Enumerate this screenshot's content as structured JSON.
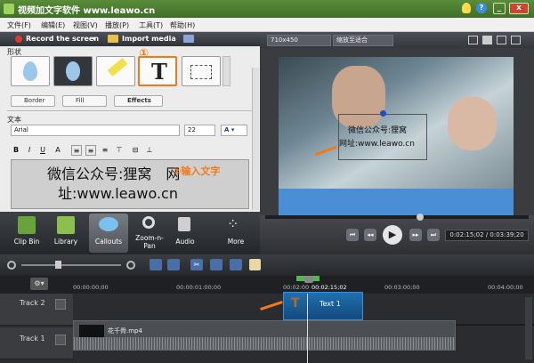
{
  "window": {
    "title": "视频加文字软件 www.leawo.cn"
  },
  "menu": [
    "文件(F)",
    "编辑(E)",
    "视图(V)",
    "播放(P)",
    "工具(T)",
    "帮助(H)"
  ],
  "toolbar": {
    "record_label": "Record the screen",
    "import_label": "Import media"
  },
  "callouts": {
    "shape_label": "形状",
    "border_label": "Border",
    "fill_label": "Fill",
    "effects_label": "Effects",
    "text_label": "文本",
    "font": "Arial",
    "font_size": "22",
    "text_content_line1": "微信公众号:狸窝　网",
    "text_content_line2": "址:www.leawo.cn",
    "step1_marker": "①",
    "step2_label": "②输入文字"
  },
  "tabs": [
    {
      "label": "Clip Bin",
      "icon": "film-icon"
    },
    {
      "label": "Library",
      "icon": "library-icon"
    },
    {
      "label": "Callouts",
      "icon": "speech-bubble-icon"
    },
    {
      "label": "Zoom-n-Pan",
      "icon": "magnifier-icon"
    },
    {
      "label": "Audio",
      "icon": "speaker-icon"
    },
    {
      "label": "More",
      "icon": "more-icon"
    }
  ],
  "preview": {
    "resolution": "710x450",
    "fit_label": "缩放至适合",
    "overlay_line1": "微信公众号:狸窝",
    "overlay_line2": "网址:www.leawo.cn",
    "time_display": "0:02:15;02 / 0:03:39;20",
    "playhead_fraction": 0.61
  },
  "timeline": {
    "ruler_ticks": [
      "00:00:00;00",
      "00:00:01:00;00",
      "00:02:00",
      "00:02:15;02",
      "00:03:00;00",
      "00:04:00;00"
    ],
    "tracks": [
      {
        "name": "Track 2",
        "clip": "Text 1"
      },
      {
        "name": "Track 1",
        "clip": "花千骨.mp4"
      }
    ]
  },
  "colors": {
    "accent": "#f07a1a",
    "title_green": "#4a7d30",
    "callout_blue": "#1f6fb0"
  }
}
